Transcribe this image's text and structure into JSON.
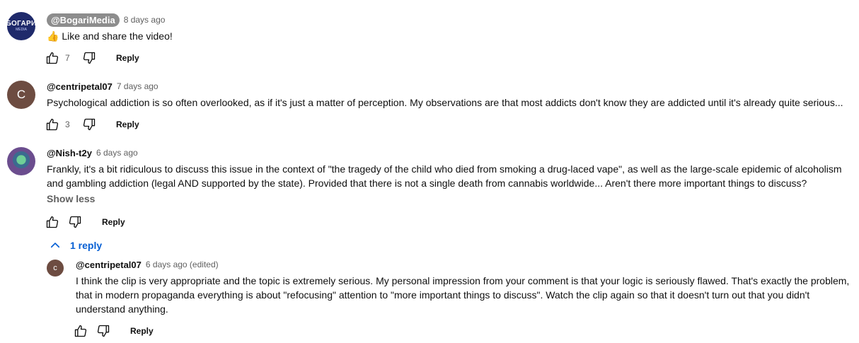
{
  "comments": [
    {
      "author": "@BogariMedia",
      "time": "8 days ago",
      "text": "👍 Like and share the video!",
      "likes": "7",
      "reply_label": "Reply",
      "avatar_text": "БОГАРИ",
      "avatar_subtext": "MEDIA"
    },
    {
      "author": "@centripetal07",
      "time": "7 days ago",
      "text": "Psychological addiction is so often overlooked, as if it's just a matter of perception. My observations are that most addicts don't know they are addicted until it's already quite serious...",
      "likes": "3",
      "reply_label": "Reply",
      "avatar_letter": "C"
    },
    {
      "author": "@Nish-t2y",
      "time": "6 days ago",
      "text": "Frankly, it's a bit ridiculous to discuss this issue in the context of \"the tragedy of the child who died from smoking a drug-laced vape\", as well as the large-scale epidemic of alcoholism and gambling addiction (legal AND supported by the state). Provided that there is not a single death from cannabis worldwide... Aren't there more important things to discuss?",
      "show_less": "Show less",
      "reply_label": "Reply",
      "replies_toggle": "1 reply"
    }
  ],
  "reply": {
    "author": "@centripetal07",
    "time": "6 days ago (edited)",
    "text": "I think the clip is very appropriate and the topic is extremely serious. My personal impression from your comment is that your logic is seriously flawed. That's exactly the problem, that in modern propaganda everything is about \"refocusing\" attention to \"more important things to discuss\". Watch the clip again so that it doesn't turn out that you didn't understand anything.",
    "reply_label": "Reply",
    "avatar_letter": "c"
  },
  "colors": {
    "link_blue": "#065fd4",
    "secondary_text": "#606060",
    "avatar_brown": "#6d4c41",
    "bogari_navy": "#1f2a6b"
  },
  "icons": [
    "thumb-up-icon",
    "thumb-down-icon",
    "chevron-up-icon"
  ]
}
